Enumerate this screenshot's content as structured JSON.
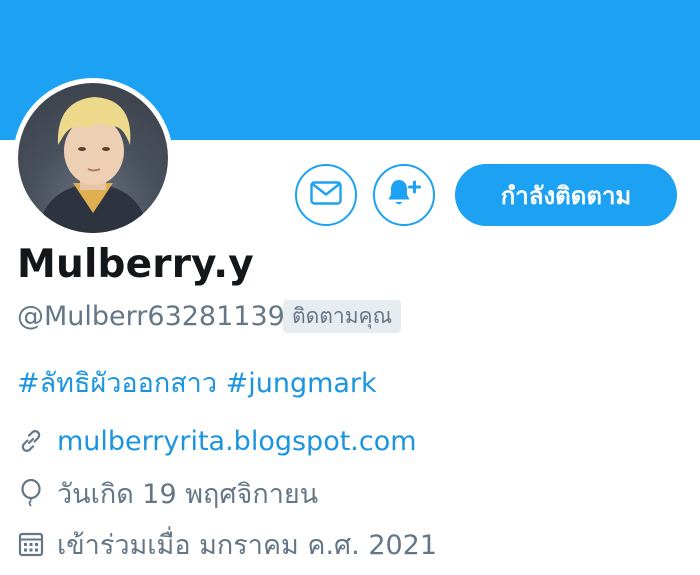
{
  "profile": {
    "name": "Mulberry.y",
    "handle": "@Mulberr63281139",
    "follows_you_badge": "ติดตามคุณ",
    "bio": "#ลัทธิผัวออกสาว #jungmark",
    "website": "mulberryrita.blogspot.com",
    "birthday": "วันเกิด 19 พฤศจิกายน",
    "joined": "เข้าร่วมเมื่อ มกราคม ค.ศ. 2021"
  },
  "actions": {
    "follow_label": "กำลังติดตาม",
    "message_icon": "mail-icon",
    "notify_icon": "bell-plus-icon"
  },
  "colors": {
    "accent": "#1da1f2",
    "link": "#1b95e0",
    "secondary_text": "#657786",
    "badge_bg": "#e6ecf0"
  }
}
